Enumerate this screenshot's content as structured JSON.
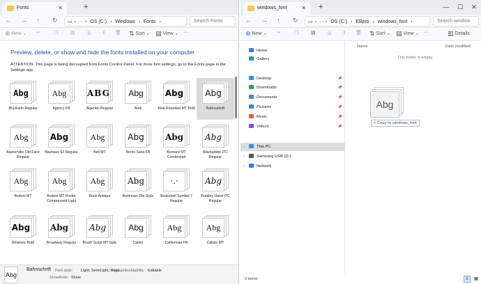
{
  "left_window": {
    "tab_title": "Fonts",
    "address": [
      "OS (C:)",
      "›",
      "Windows",
      "›",
      "Fonts",
      "›"
    ],
    "search_placeholder": "Search Fonts",
    "toolbar": {
      "new": "New",
      "sort": "Sort",
      "view": "View",
      "more": "···"
    },
    "heading": "Preview, delete, or show and hide the fonts installed on your computer",
    "attention": "ATTENTION: This page is being decoupled from Fonts Control Panel. For more font settings, go to the Fonts page in the Settings app.",
    "fonts": [
      {
        "name": "8514oem Regular",
        "sample": "Abg"
      },
      {
        "name": "Agency FB",
        "sample": "Abg"
      },
      {
        "name": "Algerian Regular",
        "sample": "ABG"
      },
      {
        "name": "Arial",
        "sample": "Abg"
      },
      {
        "name": "Arial Rounded MT Bold",
        "sample": "Abg"
      },
      {
        "name": "Bahnschrift",
        "sample": "Abg"
      },
      {
        "name": "Baskerville Old Face Regular",
        "sample": "Abg"
      },
      {
        "name": "Bauhaus 93 Regular",
        "sample": "Abg"
      },
      {
        "name": "Bell MT",
        "sample": "Abg"
      },
      {
        "name": "Berlin Sans FB",
        "sample": "Abg"
      },
      {
        "name": "Bernard MT Condensed",
        "sample": "Abg"
      },
      {
        "name": "Blackadder ITC Regular",
        "sample": "Abg"
      },
      {
        "name": "Bodoni MT",
        "sample": "Abg"
      },
      {
        "name": "Bodoni MT Poster Compressed Light",
        "sample": "Abg"
      },
      {
        "name": "Book Antiqua",
        "sample": "Abg"
      },
      {
        "name": "Bookman Old Style",
        "sample": "Abg"
      },
      {
        "name": "Bookshelf Symbol 7 Regular",
        "sample": "·.·"
      },
      {
        "name": "Bradley Hand ITC Regular",
        "sample": "Abg"
      },
      {
        "name": "Britannic Bold",
        "sample": "Abg"
      },
      {
        "name": "Broadway Regular",
        "sample": "Abg"
      },
      {
        "name": "Brush Script MT Italic",
        "sample": "Abg"
      },
      {
        "name": "Calibri",
        "sample": "Abg"
      },
      {
        "name": "Californian FB",
        "sample": "Abg"
      },
      {
        "name": "Calisto MT",
        "sample": "Abg"
      }
    ],
    "status": {
      "name": "Bahnschrift",
      "style_label": "Font style:",
      "style_value": "Light; SemiLight; Regu...",
      "embed_label": "Font embeddability:",
      "embed_value": "Editable",
      "showhide_label": "Show/hide:",
      "showhide_value": "Show",
      "preview": "Abg"
    }
  },
  "right_window": {
    "tab_title": "windows_font",
    "address": [
      "OS (C:)",
      "›",
      "EBpro",
      "›",
      "windows_font",
      "›"
    ],
    "search_placeholder": "Search window",
    "toolbar": {
      "new": "New",
      "sort": "Sort",
      "view": "View",
      "more": "···",
      "details": "Details"
    },
    "nav_items": [
      {
        "label": "Home",
        "icon": "home-icon",
        "color": "#3b7dd8",
        "pinned": false
      },
      {
        "label": "Gallery",
        "icon": "gallery-icon",
        "color": "#2a9d8f",
        "pinned": false
      },
      {
        "label": "Desktop",
        "icon": "desktop-icon",
        "color": "#3b8fe0",
        "pinned": true
      },
      {
        "label": "Downloads",
        "icon": "downloads-icon",
        "color": "#2e9e5b",
        "pinned": true
      },
      {
        "label": "Documents",
        "icon": "documents-icon",
        "color": "#5a7fbf",
        "pinned": true
      },
      {
        "label": "Pictures",
        "icon": "pictures-icon",
        "color": "#3a86d1",
        "pinned": true
      },
      {
        "label": "Music",
        "icon": "music-icon",
        "color": "#e0603b",
        "pinned": true
      },
      {
        "label": "Videos",
        "icon": "videos-icon",
        "color": "#8a4fd1",
        "pinned": true
      },
      {
        "label": "This PC",
        "icon": "pc-icon",
        "color": "#3b8fe0",
        "pinned": false
      },
      {
        "label": "Samsung USB (D:)",
        "icon": "usb-icon",
        "color": "#555555",
        "pinned": false
      },
      {
        "label": "Network",
        "icon": "network-icon",
        "color": "#3b7dd8",
        "pinned": false
      }
    ],
    "columns": {
      "name": "Name",
      "date": "Date modified"
    },
    "empty_text": "This folder is empty.",
    "drag_preview": "Abg",
    "copy_tooltip": "+ Copy to windows_font",
    "item_count": "0 items"
  }
}
